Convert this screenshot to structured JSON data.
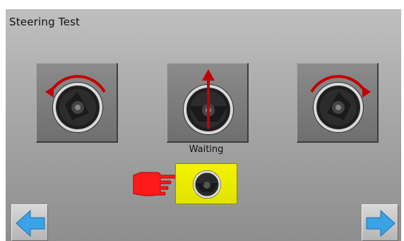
{
  "screen": {
    "title": "Steering Test",
    "status": "Waiting"
  },
  "tiles": [
    {
      "name": "steer-left",
      "icon": "steering-wheel-turn-left-icon"
    },
    {
      "name": "steer-center",
      "icon": "steering-wheel-straight-icon"
    },
    {
      "name": "steer-right",
      "icon": "steering-wheel-turn-right-icon"
    }
  ],
  "action_button": {
    "icon": "steering-wheel-icon",
    "color": "#f0f000"
  },
  "pointer": {
    "icon": "pointing-hand-icon",
    "color": "#ff1a1a"
  },
  "navigation": {
    "prev_icon": "arrow-left-icon",
    "next_icon": "arrow-right-icon",
    "arrow_color": "#3aa2e6"
  }
}
